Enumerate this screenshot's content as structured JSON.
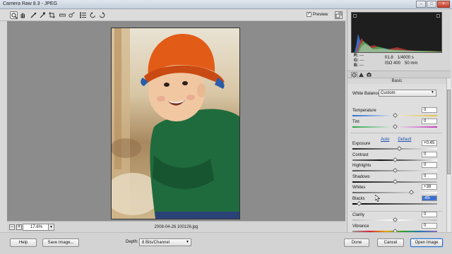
{
  "window": {
    "title": "Camera Raw 8.3  -  JPEG",
    "controls": [
      "minimize",
      "maximize",
      "close"
    ]
  },
  "toolbar": {
    "tools": [
      "zoom-tool-icon",
      "hand-tool-icon",
      "white-balance-tool-icon",
      "color-sampler-icon",
      "crop-tool-icon",
      "straighten-tool-icon",
      "spot-removal-icon",
      "preferences-icon",
      "rotate-left-icon",
      "rotate-right-icon"
    ],
    "preview_label": "Preview",
    "preview_checked": true
  },
  "status": {
    "zoom_value": "17.6%",
    "filename": "2008-04-26 100126.jpg"
  },
  "readout": {
    "r_label": "R:",
    "g_label": "G:",
    "b_label": "B:",
    "r_value": "---",
    "g_value": "---",
    "b_value": "---",
    "aperture": "f/1.8",
    "shutter": "1/4000 s",
    "iso": "ISO 400",
    "focal": "50 mm"
  },
  "panel": {
    "title": "Basic",
    "white_balance_label": "White Balance:",
    "white_balance_value": "Custom",
    "auto_label": "Auto",
    "default_label": "Default",
    "sliders": [
      {
        "label": "Temperature",
        "value": "0",
        "level": 0.5,
        "gradient": "linear-gradient(90deg,#2c6fd6,#e8e8e8,#e5c13a)"
      },
      {
        "label": "Tint",
        "value": "0",
        "level": 0.5,
        "gradient": "linear-gradient(90deg,#2da84a,#e8e8e8,#c23bbd)"
      },
      {
        "label": "Exposure",
        "value": "+0.45",
        "level": 0.55,
        "gradient": "linear-gradient(90deg,#222,#fafafa)"
      },
      {
        "label": "Contrast",
        "value": "0",
        "level": 0.5,
        "gradient": "linear-gradient(90deg,#777,#111,#777,#fff)"
      },
      {
        "label": "Highlights",
        "value": "0",
        "level": 0.5,
        "gradient": "linear-gradient(90deg,#555,#f2f2f2)"
      },
      {
        "label": "Shadows",
        "value": "0",
        "level": 0.5,
        "gradient": "linear-gradient(90deg,#111,#bbb)"
      },
      {
        "label": "Whites",
        "value": "+38",
        "level": 0.69,
        "gradient": "linear-gradient(90deg,#666,#fff)"
      },
      {
        "label": "Blacks",
        "value": "-85",
        "level": 0.075,
        "selected": true,
        "gradient": "linear-gradient(90deg,#000,#999)"
      },
      {
        "label": "Clarity",
        "value": "0",
        "level": 0.5,
        "gradient": "linear-gradient(90deg,#bbb,#fff,#bbb)"
      },
      {
        "label": "Vibrance",
        "value": "0",
        "level": 0.5,
        "gradient": "linear-gradient(90deg,#999,#d7263d,#e8a500,#2ca02c,#1f77b4,#9467bd)"
      }
    ]
  },
  "bottom": {
    "help_label": "Help",
    "save_label": "Save Image...",
    "depth_label": "Depth:",
    "depth_value": "8 Bits/Channel",
    "done_label": "Done",
    "cancel_label": "Cancel",
    "open_label": "Open Image"
  },
  "colors": {
    "accent": "#3b6fb5",
    "selection": "#3a6fd0",
    "canvas": "#8c8c8c"
  }
}
